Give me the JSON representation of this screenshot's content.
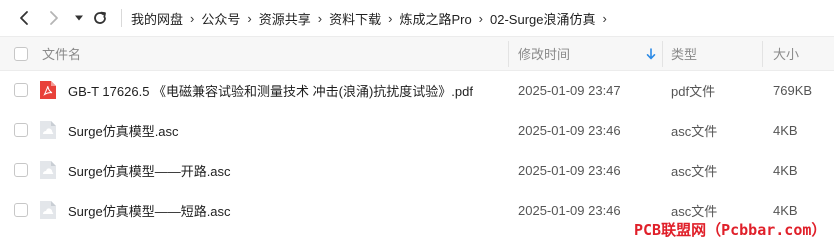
{
  "toolbar": {
    "back_icon": "chevron-left-icon",
    "forward_icon": "chevron-right-icon",
    "history_icon": "caret-down-icon",
    "refresh_icon": "refresh-icon",
    "breadcrumbs": [
      "我的网盘",
      "公众号",
      "资源共享",
      "资料下载",
      "炼成之路Pro",
      "02-Surge浪涌仿真"
    ],
    "separator": "›"
  },
  "table": {
    "headers": {
      "name": "文件名",
      "modified": "修改时间",
      "type": "类型",
      "size": "大小"
    },
    "sort_icon": "sort-down-arrow-icon",
    "sort_color": "#2b8ae6",
    "rows": [
      {
        "name": "GB-T 17626.5 《电磁兼容试验和测量技术 冲击(浪涌)抗扰度试验》.pdf",
        "modified": "2025-01-09 23:47",
        "type": "pdf文件",
        "size": "769KB",
        "icon": "pdf-file-icon"
      },
      {
        "name": "Surge仿真模型.asc",
        "modified": "2025-01-09 23:46",
        "type": "asc文件",
        "size": "4KB",
        "icon": "generic-file-icon"
      },
      {
        "name": "Surge仿真模型——开路.asc",
        "modified": "2025-01-09 23:46",
        "type": "asc文件",
        "size": "4KB",
        "icon": "generic-file-icon"
      },
      {
        "name": "Surge仿真模型——短路.asc",
        "modified": "2025-01-09 23:46",
        "type": "asc文件",
        "size": "4KB",
        "icon": "generic-file-icon"
      }
    ]
  },
  "watermark": {
    "text": "PCB联盟网（Pcbbar.com）",
    "color": "#e0202a"
  }
}
